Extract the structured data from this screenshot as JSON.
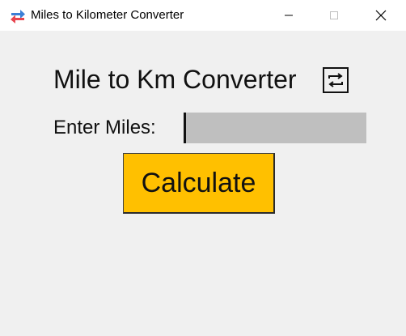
{
  "window": {
    "title": "Miles to Kilometer Converter",
    "app_icon": "swap-arrows-icon",
    "controls": {
      "minimize": "minimize-icon",
      "maximize": "maximize-icon",
      "close": "close-icon"
    }
  },
  "main": {
    "heading": "Mile to Km Converter",
    "heading_icon": "swap-icon",
    "miles_label": "Enter Miles:",
    "miles_input_value": "",
    "calculate_label": "Calculate"
  },
  "colors": {
    "title_bar": "#ffffff",
    "background": "#f0f0f0",
    "input_bg": "#bfbfbf",
    "button_bg": "#ffc000",
    "icon_red": "#e8454f",
    "icon_blue": "#3b7fd6"
  }
}
